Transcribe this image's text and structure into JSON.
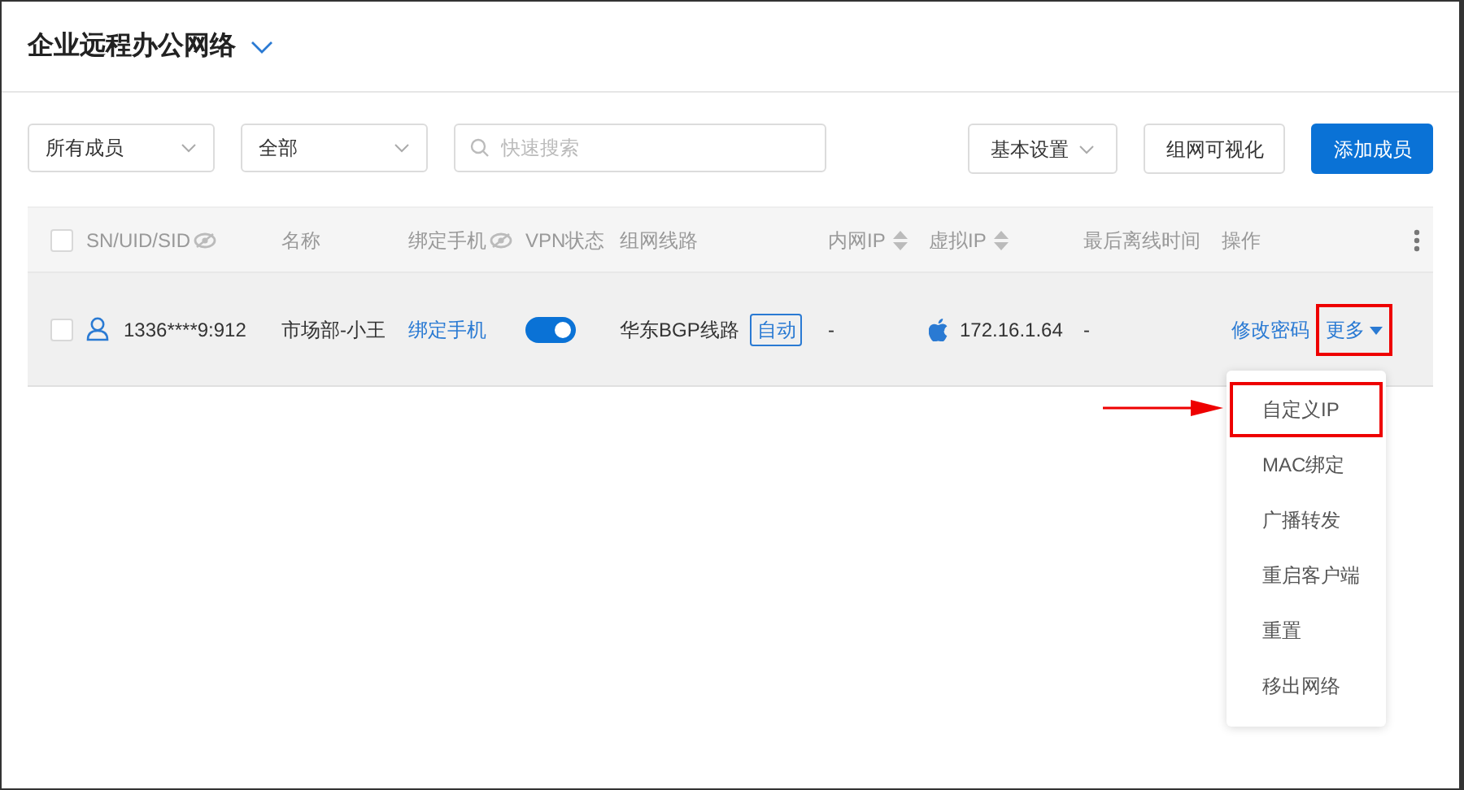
{
  "header": {
    "title": "企业远程办公网络",
    "expanded": false
  },
  "toolbar": {
    "filters": [
      {
        "value": "所有成员"
      },
      {
        "value": "全部"
      }
    ],
    "search": {
      "placeholder": "快速搜索"
    },
    "buttons": [
      {
        "label": "基本设置",
        "kind": "dropdown"
      },
      {
        "label": "组网可视化",
        "kind": "plain"
      },
      {
        "label": "添加成员",
        "kind": "primary"
      }
    ]
  },
  "table": {
    "select_all": {
      "checked": false
    },
    "columns": [
      {
        "label": "SN/UID/SID",
        "kind": "eye"
      },
      {
        "label": "名称",
        "kind": "plain"
      },
      {
        "label": "绑定手机",
        "kind": "eye"
      },
      {
        "label": "VPN状态",
        "kind": "plain"
      },
      {
        "label": "组网线路",
        "kind": "plain"
      },
      {
        "label": "内网IP",
        "kind": "sort"
      },
      {
        "label": "虚拟IP",
        "kind": "sort"
      },
      {
        "label": "最后离线时间",
        "kind": "plain"
      },
      {
        "label": "操作",
        "kind": "plain"
      }
    ],
    "rows": [
      {
        "checked": false,
        "id": "1336****9:912",
        "name": "市场部-小王",
        "phone_link": "绑定手机",
        "vpn_on": true,
        "route": "华东BGP线路",
        "route_tag": "自动",
        "lan_ip": "-",
        "virtual_ip": "172.16.1.64",
        "last_offline": "-",
        "actions": {
          "link": "修改密码",
          "more": "更多",
          "more_highlighted": true
        }
      }
    ]
  },
  "more_menu": {
    "items": [
      {
        "label": "自定义IP",
        "highlighted": true
      },
      {
        "label": "MAC绑定",
        "highlighted": false
      },
      {
        "label": "广播转发",
        "highlighted": false
      },
      {
        "label": "重启客户端",
        "highlighted": false
      },
      {
        "label": "重置",
        "highlighted": false
      },
      {
        "label": "移出网络",
        "highlighted": false
      }
    ]
  }
}
